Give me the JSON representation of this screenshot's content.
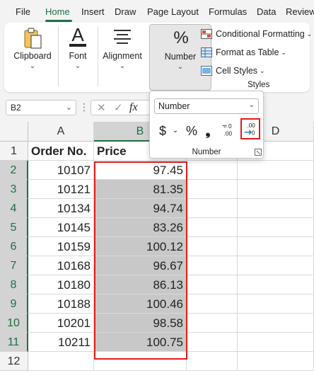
{
  "menu": {
    "tabs": [
      "File",
      "Home",
      "Insert",
      "Draw",
      "Page Layout",
      "Formulas",
      "Data",
      "Review"
    ],
    "active": "Home"
  },
  "ribbon": {
    "clipboard": "Clipboard",
    "font": "Font",
    "alignment": "Alignment",
    "number": "Number",
    "conditional_formatting": "Conditional Formatting",
    "format_as_table": "Format as Table",
    "cell_styles": "Cell Styles",
    "styles_group": "Styles"
  },
  "formula_bar": {
    "name_box": "B2",
    "fx": "fx"
  },
  "number_panel": {
    "format_value": "Number",
    "currency": "$",
    "percent": "%",
    "comma": "❟",
    "group_label": "Number"
  },
  "sheet": {
    "columns": [
      "A",
      "B",
      "C",
      "D"
    ],
    "rows": [
      "1",
      "2",
      "3",
      "4",
      "5",
      "6",
      "7",
      "8",
      "9",
      "10",
      "11",
      "12"
    ],
    "headers": {
      "a": "Order No.",
      "b": "Price"
    },
    "data": [
      {
        "order": "10107",
        "price": "97.45"
      },
      {
        "order": "10121",
        "price": "81.35"
      },
      {
        "order": "10134",
        "price": "94.74"
      },
      {
        "order": "10145",
        "price": "83.26"
      },
      {
        "order": "10159",
        "price": "100.12"
      },
      {
        "order": "10168",
        "price": "96.67"
      },
      {
        "order": "10180",
        "price": "86.13"
      },
      {
        "order": "10188",
        "price": "100.46"
      },
      {
        "order": "10201",
        "price": "98.58"
      },
      {
        "order": "10211",
        "price": "100.75"
      }
    ]
  },
  "colors": {
    "accent": "#1f6e43",
    "highlight": "#e31b1b",
    "selection": "#c8c8c8"
  }
}
